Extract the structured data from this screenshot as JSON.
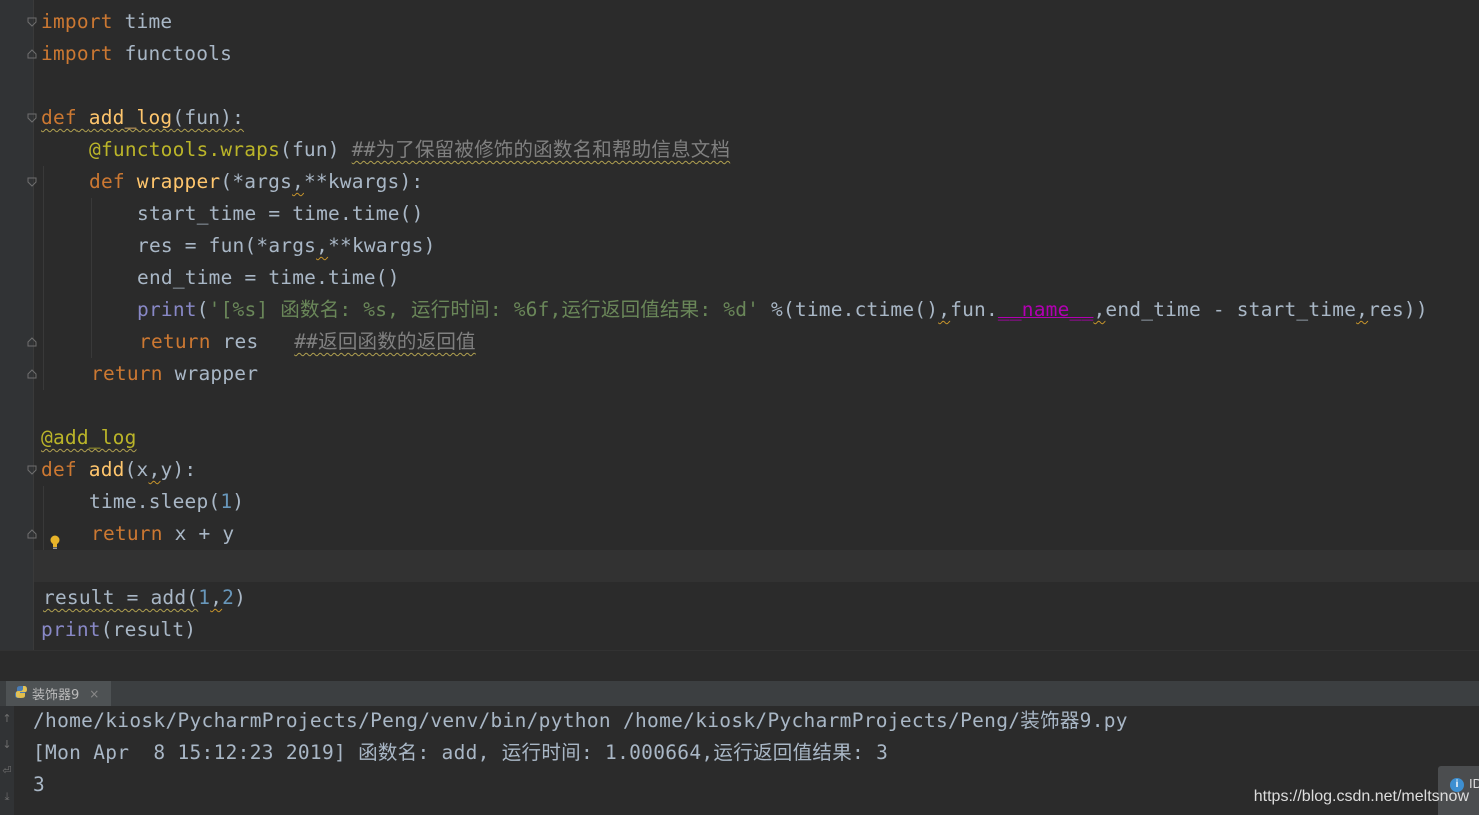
{
  "editor": {
    "lines": {
      "l1": [
        "import",
        "time"
      ],
      "l2": [
        "import",
        "functools"
      ],
      "l4": [
        "def",
        "add_log",
        "(fun):"
      ],
      "l5": [
        "@functools.wraps",
        "(fun) ",
        "##为了保留被修饰的函数名和帮助信息文档"
      ],
      "l6": [
        "def",
        "wrapper",
        "(*args",
        ",",
        "**kwargs):"
      ],
      "l7": "start_time = time.time()",
      "l8": [
        "res = fun(*args",
        ",",
        "**kwargs)"
      ],
      "l9": "end_time = time.time()",
      "l10": [
        "print",
        "(",
        "'[%s] 函数名: %s, 运行时间: %6f,运行返回值结果: %d'",
        " %(time.ctime()",
        ",",
        "fun.",
        "__name__",
        ",",
        "end_time - start_time",
        ",",
        "res))"
      ],
      "l11": [
        "return",
        " res   ",
        "##返回函数的返回值"
      ],
      "l12": [
        "return",
        " wrapper"
      ],
      "l14": "@add_log",
      "l15": [
        "def",
        "add",
        "(x",
        ",",
        "y):"
      ],
      "l16": [
        "time.sleep(",
        "1",
        ")"
      ],
      "l17": [
        "return",
        " x + y"
      ],
      "l19": [
        "result = add(",
        "1",
        ",",
        "2",
        ")"
      ],
      "l20": [
        "print",
        "(result)"
      ]
    }
  },
  "run_panel": {
    "tab_label": "装饰器9",
    "tab_close": "×",
    "output": [
      "/home/kiosk/PycharmProjects/Peng/venv/bin/python /home/kiosk/PycharmProjects/Peng/装饰器9.py",
      "[Mon Apr  8 15:12:23 2019] 函数名: add, 运行时间: 1.000664,运行返回值结果: 3",
      "3"
    ],
    "buttons": [
      "↑",
      "↓",
      "⏎",
      "⤓"
    ]
  },
  "watermark": "https://blog.csdn.net/meltsnow",
  "notification": {
    "label": "ID"
  },
  "colors": {
    "background": "#2b2b2b",
    "keyword": "#cc7832",
    "function": "#ffc66d",
    "decorator": "#bbb529",
    "string": "#6a8759",
    "number": "#6897bb",
    "comment": "#808080",
    "builtin": "#8888c6",
    "magic": "#b200b2"
  }
}
